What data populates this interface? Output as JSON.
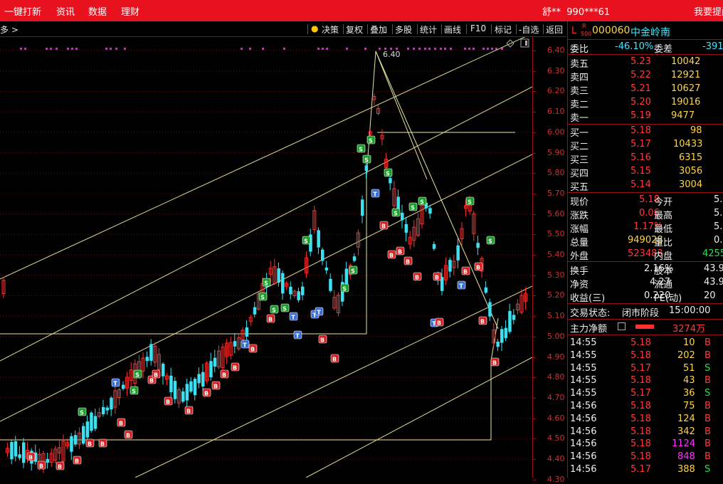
{
  "topbar": {
    "menu": [
      "一键打新",
      "资讯",
      "数据",
      "理财"
    ],
    "account_user": "舒**",
    "account_id": "990***61",
    "help": "我要提问"
  },
  "toolbar": {
    "left_label": "多 >",
    "buttons": [
      "决策",
      "复权",
      "叠加",
      "多股",
      "统计",
      "画线",
      "F10",
      "标记",
      "-自选",
      "返回"
    ]
  },
  "chart": {
    "high_label": "6.40",
    "price_ticks": [
      "6.40",
      "6.30",
      "6.20",
      "6.10",
      "6.00",
      "5.90",
      "5.80",
      "5.70",
      "5.60",
      "5.50",
      "5.40",
      "5.30",
      "5.20",
      "5.10",
      "5.00",
      "4.90",
      "4.80",
      "4.70",
      "4.60",
      "4.50",
      "4.40",
      "4.30"
    ],
    "colors": {
      "up": "#ff3030",
      "down": "#3de0f0",
      "channel": "#e8e8a0",
      "dots": "#c030c0"
    }
  },
  "stock": {
    "badge_l": "L",
    "badge_r": "R",
    "badge_500": "500",
    "code": "000060",
    "name": "中金岭南"
  },
  "order_ratio": {
    "label": "委比",
    "value": "-46.10%",
    "diff_label": "委差",
    "diff_value": "-391"
  },
  "asks": [
    {
      "label": "卖五",
      "price": "5.23",
      "vol": "10042"
    },
    {
      "label": "卖四",
      "price": "5.22",
      "vol": "12921"
    },
    {
      "label": "卖三",
      "price": "5.21",
      "vol": "10627"
    },
    {
      "label": "卖二",
      "price": "5.20",
      "vol": "19016"
    },
    {
      "label": "卖一",
      "price": "5.19",
      "vol": "9477"
    }
  ],
  "bids": [
    {
      "label": "买一",
      "price": "5.18",
      "vol": "98"
    },
    {
      "label": "买二",
      "price": "5.17",
      "vol": "10433"
    },
    {
      "label": "买三",
      "price": "5.16",
      "vol": "6315"
    },
    {
      "label": "买四",
      "price": "5.15",
      "vol": "3056"
    },
    {
      "label": "买五",
      "price": "5.14",
      "vol": "3004"
    }
  ],
  "quote": [
    {
      "l1": "现价",
      "v1": "5.18",
      "l2": "今开",
      "v2": "5."
    },
    {
      "l1": "涨跌",
      "v1": "0.06",
      "l2": "最高",
      "v2": "5."
    },
    {
      "l1": "涨幅",
      "v1": "1.17%",
      "l2": "最低",
      "v2": "5."
    },
    {
      "l1": "总量",
      "v1": "949028",
      "l2": "量比",
      "v2": "0."
    },
    {
      "l1": "外盘",
      "v1": "523483",
      "l2": "内盘",
      "v2": "4255"
    }
  ],
  "fundamentals": [
    {
      "l1": "换手",
      "v1": "2.16%",
      "l2": "股本",
      "v2": "43.9"
    },
    {
      "l1": "净资",
      "v1": "4.27",
      "l2": "流通",
      "v2": "43.9"
    },
    {
      "l1": "收益(三)",
      "v1": "0.220",
      "l2": "PE(动)",
      "v2": "20"
    }
  ],
  "trade_status": {
    "label": "交易状态:",
    "value": "闭市阶段",
    "time": "15:00:00"
  },
  "main_flow": {
    "label": "主力净额",
    "value": "3274万",
    "bar_color": "#ff3030"
  },
  "ticks": [
    {
      "t": "14:55",
      "p": "5.18",
      "v": "10",
      "s": "B"
    },
    {
      "t": "14:55",
      "p": "5.18",
      "v": "202",
      "s": "B"
    },
    {
      "t": "14:55",
      "p": "5.17",
      "v": "51",
      "s": "S"
    },
    {
      "t": "14:55",
      "p": "5.18",
      "v": "43",
      "s": "B"
    },
    {
      "t": "14:55",
      "p": "5.17",
      "v": "36",
      "s": "S"
    },
    {
      "t": "14:56",
      "p": "5.18",
      "v": "75",
      "s": "B"
    },
    {
      "t": "14:56",
      "p": "5.18",
      "v": "124",
      "s": "B"
    },
    {
      "t": "14:56",
      "p": "5.18",
      "v": "342",
      "s": "B"
    },
    {
      "t": "14:56",
      "p": "5.18",
      "v": "1124",
      "s": "B"
    },
    {
      "t": "14:56",
      "p": "5.18",
      "v": "848",
      "s": "B"
    },
    {
      "t": "14:56",
      "p": "5.17",
      "v": "388",
      "s": "S"
    }
  ]
}
